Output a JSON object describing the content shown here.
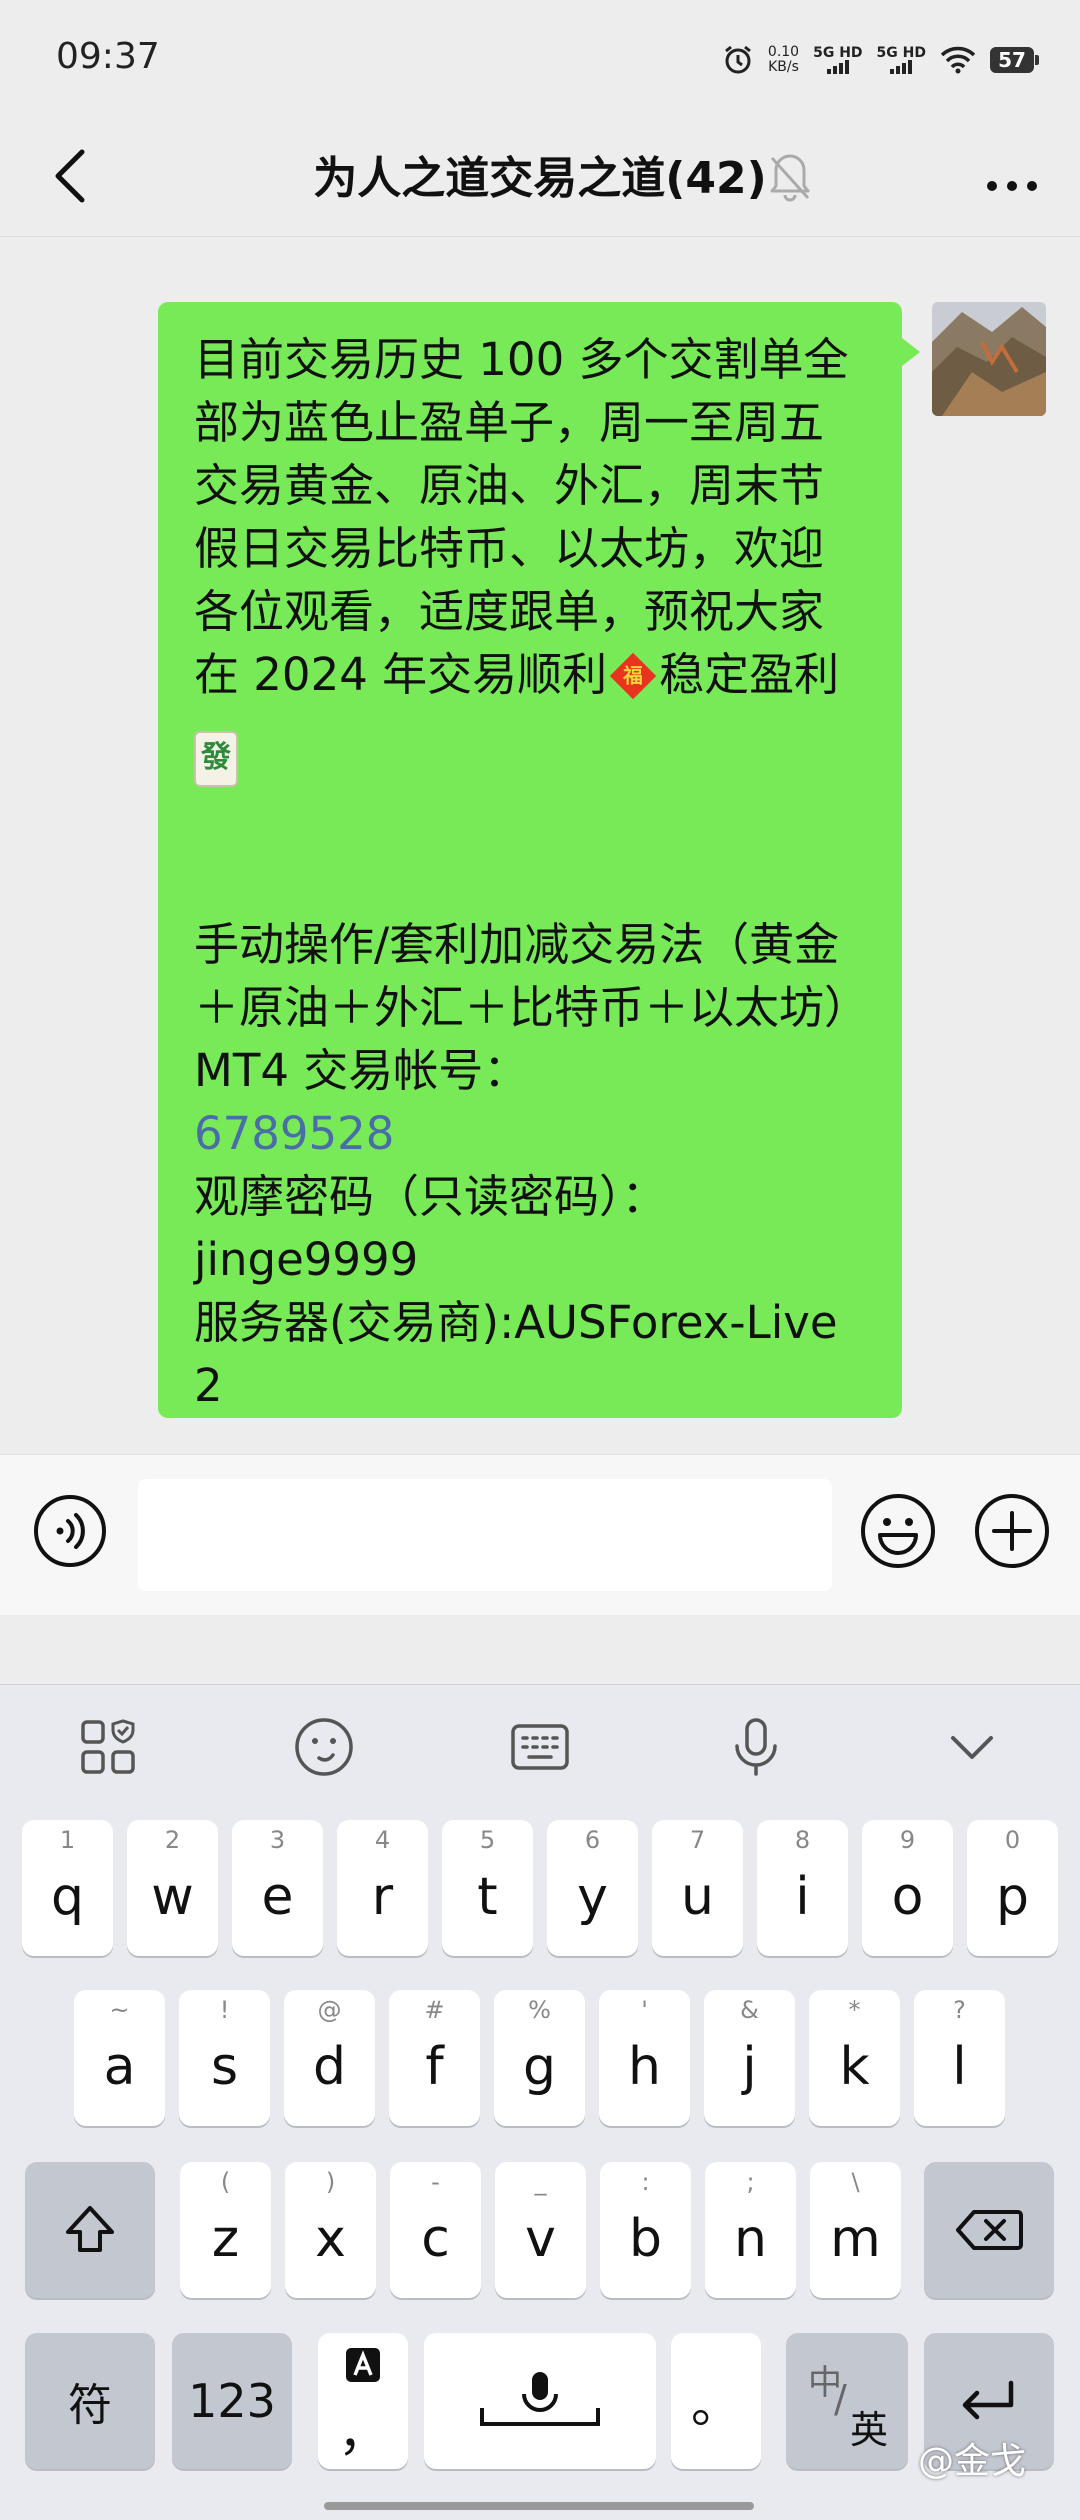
{
  "status": {
    "time": "09:37",
    "net_speed": "0.10",
    "net_unit": "KB/s",
    "sim1": "5G HD",
    "sim2": "5G HD",
    "battery": "57"
  },
  "nav": {
    "title": "为人之道交易之道(42)"
  },
  "message": {
    "p1a": "目前交易历史 100 多个交割单全部为蓝色止盈单子，周一至周五交易黄金、原油、外汇，周末节假日交易比特币、以太坊，欢迎各位观看，适度跟单，预祝大家在 2024 年交易顺利",
    "p1b": "稳定盈利",
    "emoji_fu": "福",
    "emoji_fa": "發",
    "line1": "手动操作/套利加减交易法（黄金＋原油＋外汇＋比特币＋以太坊）",
    "line2": "MT4 交易帐号：",
    "account": "6789528",
    "line3": "观摩密码（只读密码）：",
    "password": "jinge9999",
    "line4": "服务器(交易商):AUSForex-Live 2"
  },
  "keyboard": {
    "row1": [
      {
        "sub": "1",
        "key": "q"
      },
      {
        "sub": "2",
        "key": "w"
      },
      {
        "sub": "3",
        "key": "e"
      },
      {
        "sub": "4",
        "key": "r"
      },
      {
        "sub": "5",
        "key": "t"
      },
      {
        "sub": "6",
        "key": "y"
      },
      {
        "sub": "7",
        "key": "u"
      },
      {
        "sub": "8",
        "key": "i"
      },
      {
        "sub": "9",
        "key": "o"
      },
      {
        "sub": "0",
        "key": "p"
      }
    ],
    "row2": [
      {
        "sub": "~",
        "key": "a"
      },
      {
        "sub": "!",
        "key": "s"
      },
      {
        "sub": "@",
        "key": "d"
      },
      {
        "sub": "#",
        "key": "f"
      },
      {
        "sub": "%",
        "key": "g"
      },
      {
        "sub": "'",
        "key": "h"
      },
      {
        "sub": "&",
        "key": "j"
      },
      {
        "sub": "*",
        "key": "k"
      },
      {
        "sub": "?",
        "key": "l"
      }
    ],
    "row3": [
      {
        "sub": "(",
        "key": "z"
      },
      {
        "sub": ")",
        "key": "x"
      },
      {
        "sub": "-",
        "key": "c"
      },
      {
        "sub": "_",
        "key": "v"
      },
      {
        "sub": ":",
        "key": "b"
      },
      {
        "sub": ";",
        "key": "n"
      },
      {
        "sub": "\\",
        "key": "m"
      }
    ],
    "symbols": "符",
    "numbers": "123",
    "comma": "，",
    "period": "。",
    "lang_cn": "中",
    "lang_en": "英"
  },
  "watermark": "@金戈"
}
